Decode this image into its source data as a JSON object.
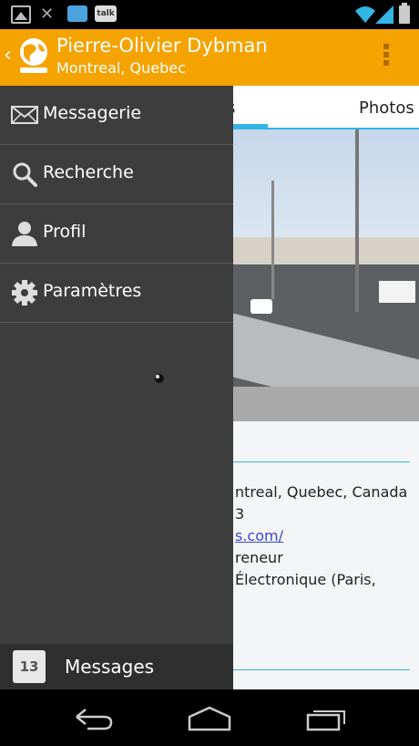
{
  "statusbar": {
    "icons": [
      "gallery-icon",
      "close-icon",
      "chat-icon",
      "talk-icon",
      "wifi-icon",
      "signal-icon",
      "battery-icon"
    ],
    "talk_label": "talk"
  },
  "actionbar": {
    "title": "Pierre-Olivier Dybman",
    "subtitle": "Montreal, Quebec",
    "color": "#f5a300"
  },
  "tabs": {
    "partial_active": "os",
    "photos": "Photos",
    "indicator_color": "#33b5e5"
  },
  "info": {
    "location": "ntreal, Quebec, Canada",
    "number_fragment": "3",
    "link": "s.com/",
    "occupation": "reneur",
    "education": "Électronique (Paris,"
  },
  "drawer": {
    "items": [
      {
        "label": "Messagerie",
        "icon": "mail-icon"
      },
      {
        "label": "Recherche",
        "icon": "search-icon"
      },
      {
        "label": "Profil",
        "icon": "person-icon"
      },
      {
        "label": "Paramètres",
        "icon": "gear-icon"
      }
    ],
    "footer": {
      "badge_count": "13",
      "label": "Messages"
    }
  },
  "navbar": {
    "buttons": [
      "back-icon",
      "home-icon",
      "recents-icon"
    ]
  }
}
